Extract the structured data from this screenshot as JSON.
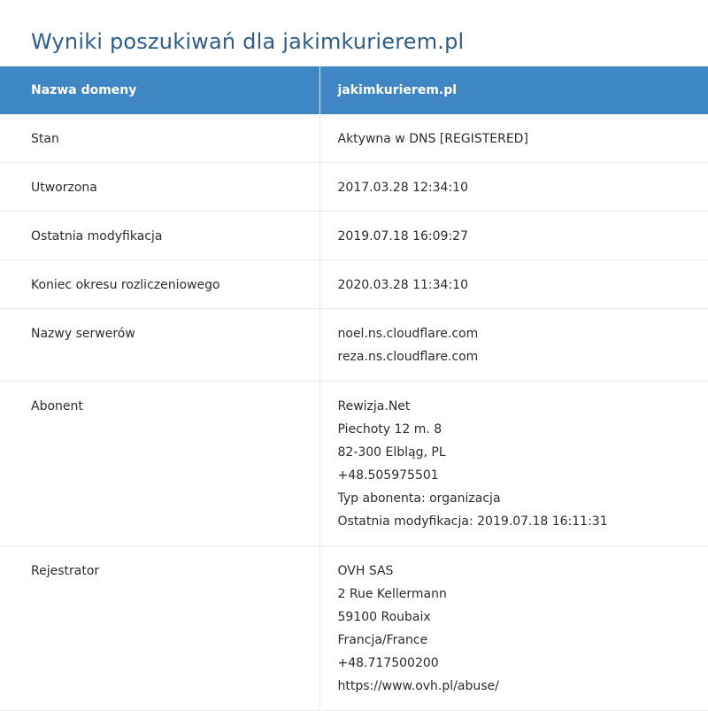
{
  "page": {
    "title": "Wyniki poszukiwań dla jakimkurierem.pl"
  },
  "table": {
    "header": {
      "key": "Nazwa domeny",
      "value": "jakimkurierem.pl"
    },
    "rows": [
      {
        "label": "Stan",
        "values": [
          "Aktywna w DNS [REGISTERED]"
        ]
      },
      {
        "label": "Utworzona",
        "values": [
          "2017.03.28 12:34:10"
        ]
      },
      {
        "label": "Ostatnia modyfikacja",
        "values": [
          "2019.07.18 16:09:27"
        ]
      },
      {
        "label": "Koniec okresu rozliczeniowego",
        "values": [
          "2020.03.28 11:34:10"
        ]
      },
      {
        "label": "Nazwy serwerów",
        "values": [
          "noel.ns.cloudflare.com",
          "reza.ns.cloudflare.com"
        ]
      },
      {
        "label": "Abonent",
        "values": [
          "Rewizja.Net",
          "Piechoty 12 m. 8",
          "82-300 Elbląg, PL",
          "+48.505975501",
          "Typ abonenta: organizacja",
          "Ostatnia modyfikacja: 2019.07.18 16:11:31"
        ]
      },
      {
        "label": "Rejestrator",
        "values": [
          "OVH SAS",
          "2 Rue Kellermann",
          "59100 Roubaix",
          "Francja/France",
          "+48.717500200",
          "https://www.ovh.pl/abuse/"
        ]
      }
    ]
  },
  "colors": {
    "header_bg": "#3f86c4",
    "title": "#2f5d8a",
    "border": "#e5ebf0"
  }
}
